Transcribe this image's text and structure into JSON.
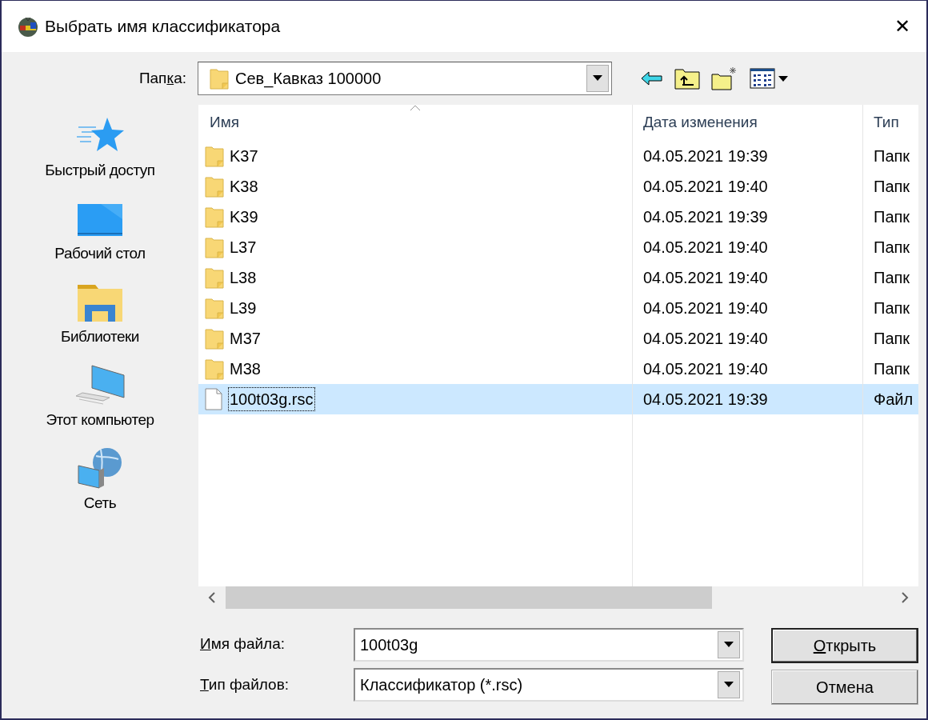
{
  "window": {
    "title": "Выбрать имя классификатора",
    "close": "✕"
  },
  "folder": {
    "label_before": "Пап",
    "access_key": "к",
    "label_after": "а:",
    "value": "Сев_Кавказ 100000"
  },
  "sidebar": {
    "items": [
      {
        "label": "Быстрый доступ",
        "kind": "star"
      },
      {
        "label": "Рабочий стол",
        "kind": "desktop"
      },
      {
        "label": "Библиотеки",
        "kind": "library"
      },
      {
        "label": "Этот компьютер",
        "kind": "computer"
      },
      {
        "label": "Сеть",
        "kind": "network"
      }
    ]
  },
  "table": {
    "columns": [
      "Имя",
      "Дата изменения",
      "Тип"
    ],
    "rows": [
      {
        "name": "K37",
        "date": "04.05.2021 19:39",
        "type": "Папк",
        "kind": "folder",
        "selected": false
      },
      {
        "name": "K38",
        "date": "04.05.2021 19:40",
        "type": "Папк",
        "kind": "folder",
        "selected": false
      },
      {
        "name": "K39",
        "date": "04.05.2021 19:39",
        "type": "Папк",
        "kind": "folder",
        "selected": false
      },
      {
        "name": "L37",
        "date": "04.05.2021 19:40",
        "type": "Папк",
        "kind": "folder",
        "selected": false
      },
      {
        "name": "L38",
        "date": "04.05.2021 19:40",
        "type": "Папк",
        "kind": "folder",
        "selected": false
      },
      {
        "name": "L39",
        "date": "04.05.2021 19:40",
        "type": "Папк",
        "kind": "folder",
        "selected": false
      },
      {
        "name": "M37",
        "date": "04.05.2021 19:40",
        "type": "Папк",
        "kind": "folder",
        "selected": false
      },
      {
        "name": "M38",
        "date": "04.05.2021 19:40",
        "type": "Папк",
        "kind": "folder",
        "selected": false
      },
      {
        "name": "100t03g.rsc",
        "date": "04.05.2021 19:39",
        "type": "Файл",
        "kind": "file",
        "selected": true
      }
    ]
  },
  "fields": [
    {
      "access_key": "И",
      "label_after": "мя файла:",
      "value": "100t03g"
    },
    {
      "access_key": "Т",
      "label_after": "ип файлов:",
      "value": "Классификатор (*.rsc)"
    }
  ],
  "buttons": [
    {
      "access_key": "О",
      "label_after": "ткрыть",
      "default": true
    },
    {
      "label_after": "Отмена",
      "default": false
    }
  ]
}
